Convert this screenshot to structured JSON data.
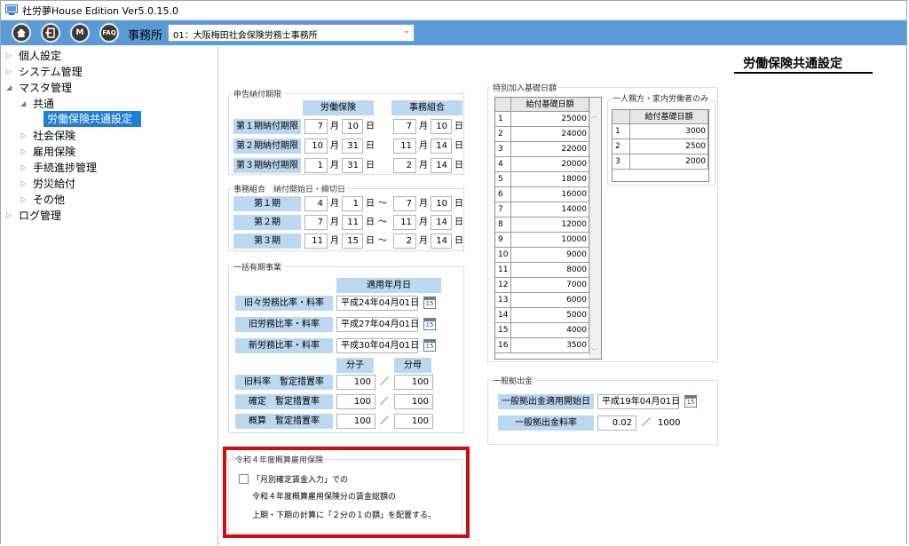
{
  "window": {
    "title": "社労夢House Edition Ver5.0.15.0"
  },
  "toolbar": {
    "buttons": [
      "家",
      "閉",
      "M",
      "FAQ"
    ],
    "office_label": "事務所",
    "office_value": "01：大阪梅田社会保険労務士事務所"
  },
  "sidebar": {
    "items": [
      {
        "label": "個人設定"
      },
      {
        "label": "システム管理"
      },
      {
        "label": "マスタ管理"
      },
      {
        "label": "共通"
      },
      {
        "label": "労働保険共通設定"
      },
      {
        "label": "社会保険"
      },
      {
        "label": "雇用保険"
      },
      {
        "label": "手続進捗管理"
      },
      {
        "label": "労災給付"
      },
      {
        "label": "その他"
      },
      {
        "label": "ログ管理"
      }
    ]
  },
  "page": {
    "title": "労働保険共通設定"
  },
  "filing": {
    "group_title": "申告納付期限",
    "col_labor": "労働保険",
    "col_office": "事務組合",
    "rows": [
      {
        "label": "第１期納付期限",
        "m1": "7",
        "d1": "10",
        "m2": "7",
        "d2": "10"
      },
      {
        "label": "第２期納付期限",
        "m1": "10",
        "d1": "31",
        "m2": "11",
        "d2": "14"
      },
      {
        "label": "第３期納付期限",
        "m1": "1",
        "d1": "31",
        "m2": "2",
        "d2": "14"
      }
    ],
    "unit_month": "月",
    "unit_day": "日"
  },
  "union": {
    "group_title": "事務組合　納付開始日・締切日",
    "rows": [
      {
        "label": "第１期",
        "m1": "4",
        "d1": "1",
        "m2": "7",
        "d2": "10"
      },
      {
        "label": "第２期",
        "m1": "7",
        "d1": "11",
        "m2": "11",
        "d2": "14"
      },
      {
        "label": "第３期",
        "m1": "11",
        "d1": "15",
        "m2": "2",
        "d2": "14"
      }
    ],
    "tilde": "～"
  },
  "lump": {
    "group_title": "一括有期事業",
    "col_date": "適用年月日",
    "rows": [
      {
        "label": "旧々労務比率・料率",
        "date": "平成24年04月01日"
      },
      {
        "label": "旧労務比率・料率",
        "date": "平成27年04月01日"
      },
      {
        "label": "新労務比率・料率",
        "date": "平成30年04月01日"
      }
    ],
    "cal_label": "15",
    "col_num": "分子",
    "col_den": "分母",
    "slash": "／",
    "rates": [
      {
        "label": "旧料率　暫定措置率",
        "num": "100",
        "den": "100"
      },
      {
        "label": "確定　暫定措置率",
        "num": "100",
        "den": "100"
      },
      {
        "label": "概算　暫定措置率",
        "num": "100",
        "den": "100"
      }
    ]
  },
  "special": {
    "group_title": "特別加入基礎日額",
    "col_header": "給付基礎日額",
    "rows": [
      {
        "idx": "1",
        "val": "25000"
      },
      {
        "idx": "2",
        "val": "24000"
      },
      {
        "idx": "3",
        "val": "22000"
      },
      {
        "idx": "4",
        "val": "20000"
      },
      {
        "idx": "5",
        "val": "18000"
      },
      {
        "idx": "6",
        "val": "16000"
      },
      {
        "idx": "7",
        "val": "14000"
      },
      {
        "idx": "8",
        "val": "12000"
      },
      {
        "idx": "9",
        "val": "10000"
      },
      {
        "idx": "10",
        "val": "9000"
      },
      {
        "idx": "11",
        "val": "8000"
      },
      {
        "idx": "12",
        "val": "7000"
      },
      {
        "idx": "13",
        "val": "6000"
      },
      {
        "idx": "14",
        "val": "5000"
      },
      {
        "idx": "15",
        "val": "4000"
      },
      {
        "idx": "16",
        "val": "3500"
      }
    ],
    "family_title": "一人親方・家内労働者のみ",
    "family_header": "給付基礎日額",
    "family_rows": [
      {
        "idx": "1",
        "val": "3000"
      },
      {
        "idx": "2",
        "val": "2500"
      },
      {
        "idx": "3",
        "val": "2000"
      }
    ]
  },
  "general": {
    "group_title": "一般拠出金",
    "start_label": "一般拠出金適用開始日",
    "start_date": "平成19年04月01日",
    "rate_label": "一般拠出金料率",
    "rate_value": "0.02",
    "slash": "／",
    "rate_den": "1000"
  },
  "reiwa": {
    "group_title": "令和４年度概算雇用保険",
    "checkbox_label": "「月別確定賃金入力」での",
    "line2": "令和４年度概算雇用保険分の賃金総額の",
    "line3": "上期・下期の計算に「２分の１の額」を配置する。",
    "checked": false
  }
}
